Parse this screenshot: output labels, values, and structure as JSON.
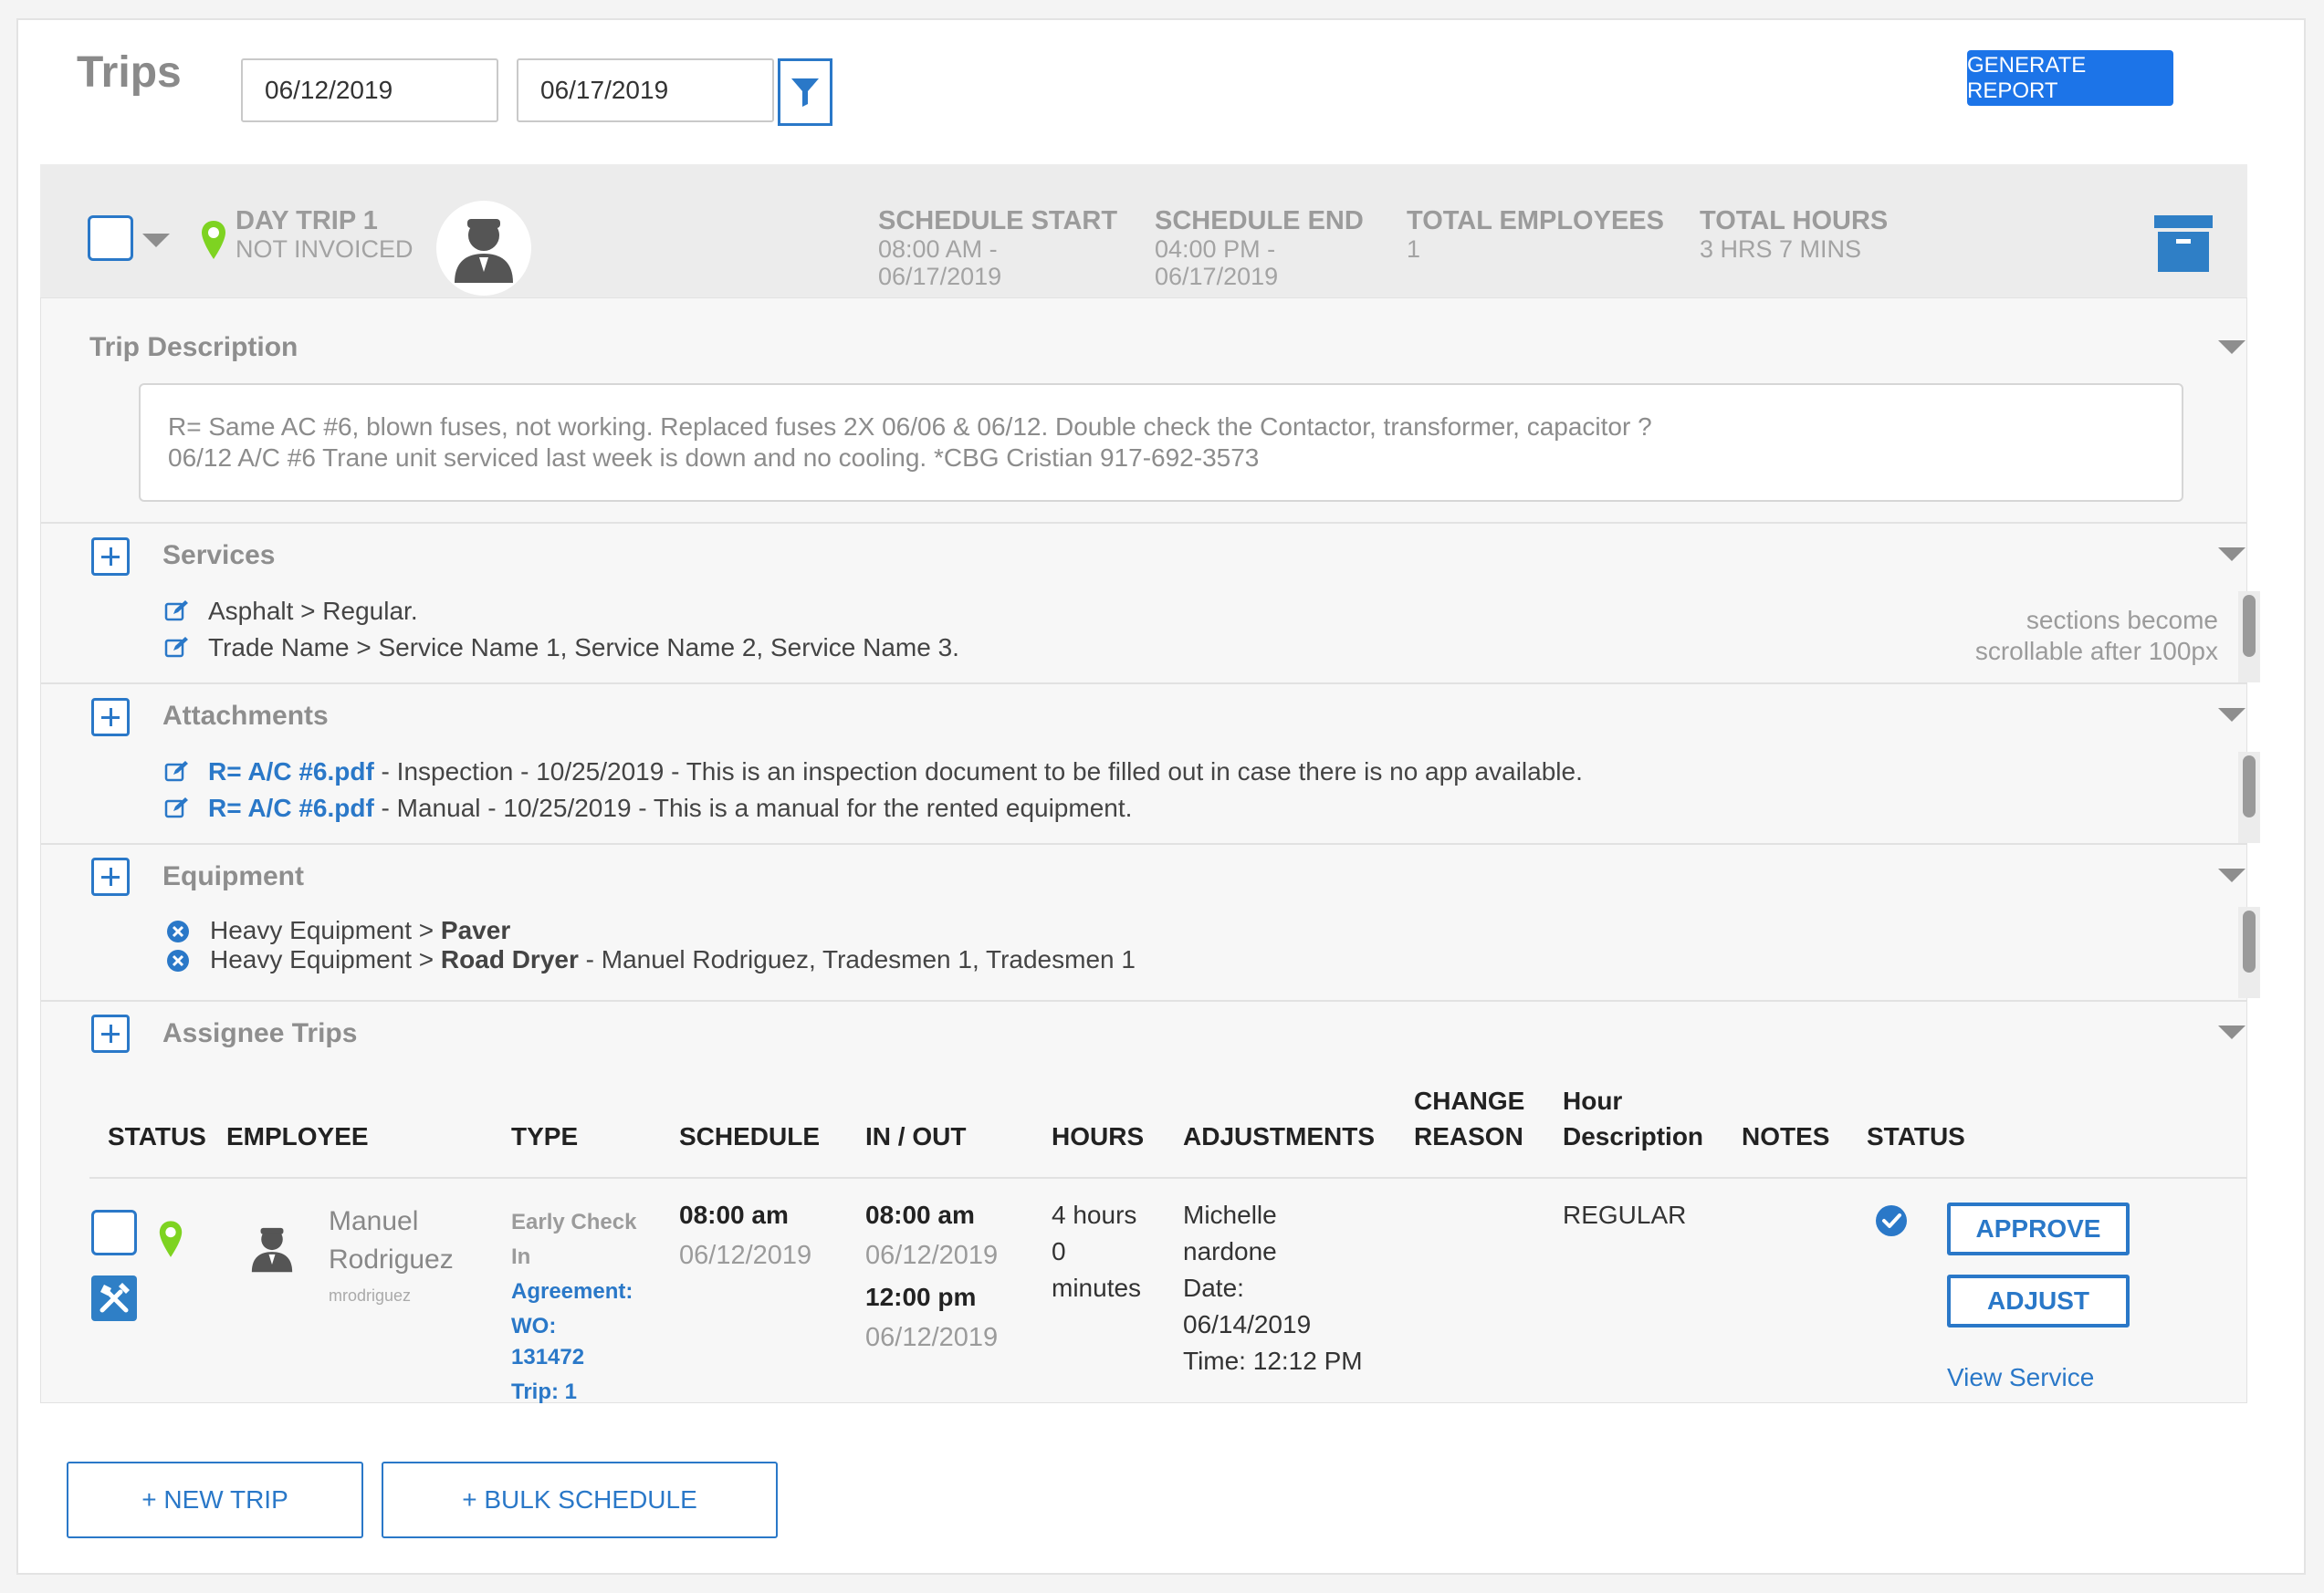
{
  "header": {
    "title": "Trips",
    "start_date": "06/12/2019",
    "end_date": "06/17/2019",
    "generate_report_label": "GENERATE REPORT"
  },
  "trip": {
    "name": "DAY TRIP 1",
    "invoice_status": "NOT INVOICED",
    "schedule_start_label": "SCHEDULE START",
    "schedule_start_time": "08:00 AM -",
    "schedule_start_date": "06/17/2019",
    "schedule_end_label": "SCHEDULE END",
    "schedule_end_time": "04:00 PM -",
    "schedule_end_date": "06/17/2019",
    "total_employees_label": "TOTAL EMPLOYEES",
    "total_employees": "1",
    "total_hours_label": "TOTAL HOURS",
    "total_hours": "3 HRS 7 MINS"
  },
  "description": {
    "title": "Trip Description",
    "line1": "R= Same AC #6, blown fuses, not working. Replaced fuses 2X 06/06 & 06/12. Double check the Contactor, transformer, capacitor ?",
    "line2": "06/12 A/C #6 Trane unit serviced last week is down and no cooling. *CBG  Cristian 917-692-3573"
  },
  "services": {
    "title": "Services",
    "items": [
      "Asphalt > Regular.",
      "Trade Name > Service Name 1, Service Name 2, Service Name 3."
    ],
    "note_line1": "sections become",
    "note_line2": "scrollable after 100px"
  },
  "attachments": {
    "title": "Attachments",
    "items": [
      {
        "file": "R= A/C #6.pdf",
        "rest": " - Inspection - 10/25/2019 - This is an inspection document to be filled out in case there is no app available."
      },
      {
        "file": "R= A/C #6.pdf",
        "rest": " - Manual - 10/25/2019 - This is a manual for the rented equipment."
      }
    ]
  },
  "equipment": {
    "title": "Equipment",
    "items": [
      {
        "prefix": "Heavy Equipment > ",
        "name": "Paver",
        "rest": ""
      },
      {
        "prefix": "Heavy Equipment > ",
        "name": "Road Dryer",
        "rest": " - Manuel Rodriguez, Tradesmen 1, Tradesmen 1"
      }
    ]
  },
  "assignee": {
    "title": "Assignee Trips",
    "columns": {
      "status": "STATUS",
      "employee": "EMPLOYEE",
      "type": "TYPE",
      "schedule": "SCHEDULE",
      "in_out": "IN / OUT",
      "hours": "HOURS",
      "adjustments": "ADJUSTMENTS",
      "change_reason_1": "CHANGE",
      "change_reason_2": "REASON",
      "hour_desc_1": "Hour",
      "hour_desc_2": "Description",
      "notes": "NOTES",
      "status2": "STATUS"
    },
    "row": {
      "first_name": "Manuel",
      "last_name": "Rodriguez",
      "username": "mrodriguez",
      "type_1": "Early Check",
      "type_2": "In",
      "agreement": "Agreement:",
      "wo": "WO:",
      "wo_number": "131472",
      "trip": "Trip: 1",
      "schedule_time": "08:00 am",
      "schedule_date": "06/12/2019",
      "in_time": "08:00 am",
      "in_date": "06/12/2019",
      "out_time": "12:00 pm",
      "out_date": "06/12/2019",
      "hours_1": "4 hours",
      "hours_2": "0",
      "hours_3": "minutes",
      "adj_1": "Michelle",
      "adj_2": "nardone",
      "adj_3": "Date:",
      "adj_4": "06/14/2019",
      "adj_5": "Time: 12:12 PM",
      "hour_description": "REGULAR",
      "approve_label": "APPROVE",
      "adjust_label": "ADJUST",
      "view_service_label": "View Service"
    }
  },
  "footer": {
    "new_trip_label": "+ NEW TRIP",
    "bulk_schedule_label": "+ BULK SCHEDULE"
  },
  "colors": {
    "accent": "#2a78c8",
    "primary_button": "#1c74e8",
    "pin_green": "#7ed321",
    "archive_blue": "#2f7fc6"
  }
}
